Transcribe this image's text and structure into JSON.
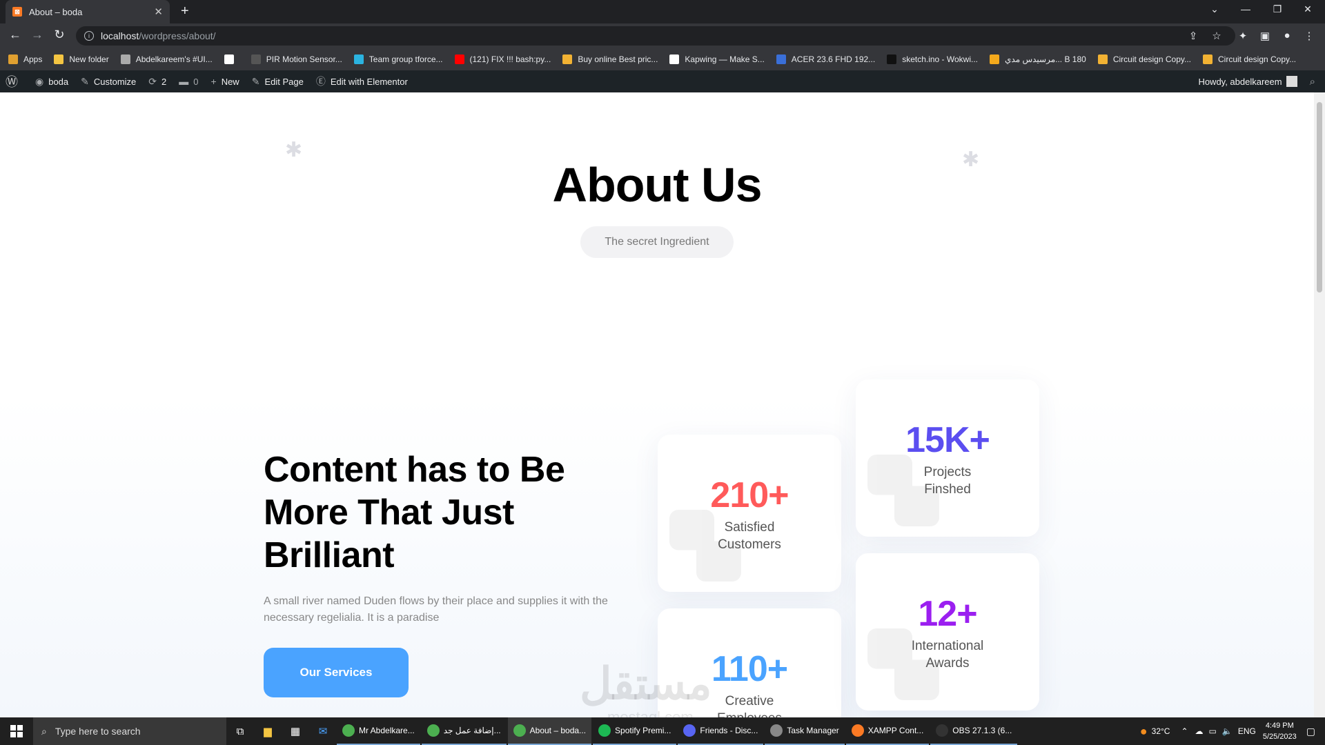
{
  "browser": {
    "tab_title": "About – boda",
    "url_host": "localhost",
    "url_path": "/wordpress/about/"
  },
  "bookmarks": [
    {
      "label": "Apps",
      "color": "#e0a030"
    },
    {
      "label": "New folder",
      "color": "#f4c542"
    },
    {
      "label": "Abdelkareem's #UI...",
      "color": "#aaaaaa"
    },
    {
      "label": "",
      "color": "#ffffff"
    },
    {
      "label": "PIR Motion Sensor...",
      "color": "#555555"
    },
    {
      "label": "Team group tforce...",
      "color": "#2bb3e0"
    },
    {
      "label": "(121) FIX !!! bash:py...",
      "color": "#ff0000"
    },
    {
      "label": "Buy online Best pric...",
      "color": "#f2b233"
    },
    {
      "label": "Kapwing — Make S...",
      "color": "#ffffff"
    },
    {
      "label": "ACER 23.6 FHD 192...",
      "color": "#3a6fd8"
    },
    {
      "label": "sketch.ino - Wokwi...",
      "color": "#111111"
    },
    {
      "label": "مرسيدس مدي... B 180",
      "color": "#f4a91c"
    },
    {
      "label": "Circuit design Copy...",
      "color": "#f2b233"
    },
    {
      "label": "Circuit design Copy...",
      "color": "#f2b233"
    }
  ],
  "adminbar": {
    "site": "boda",
    "customize": "Customize",
    "updates": "2",
    "comments": "0",
    "new": "New",
    "edit_page": "Edit Page",
    "elementor": "Edit with Elementor",
    "howdy": "Howdy, abdelkareem"
  },
  "hero": {
    "title": "About Us",
    "pill": "The secret Ingredient"
  },
  "content": {
    "heading": "Content has to Be More That Just Brilliant",
    "text": "A small river named Duden flows by their place and supplies it with the necessary regelialia. It is a paradise",
    "button": "Our Services"
  },
  "stats": [
    {
      "number": "210+",
      "label": "Satisfied Customers",
      "color": "#ff5a5a"
    },
    {
      "number": "15K+",
      "label": "Projects Finshed",
      "color": "#5b4ef0"
    },
    {
      "number": "110+",
      "label": "Creative Employees",
      "color": "#4aa3ff"
    },
    {
      "number": "12+",
      "label": "International Awards",
      "color": "#9b1ff0"
    }
  ],
  "watermark": {
    "text": "مستقل",
    "sub": "mostaql.com"
  },
  "taskbar": {
    "search_placeholder": "Type here to search",
    "apps": [
      "Mr Abdelkare...",
      "إضافة عمل جد...",
      "About – boda...",
      "Spotify Premi...",
      "Friends - Disc...",
      "Task Manager",
      "XAMPP Cont...",
      "OBS 27.1.3 (6..."
    ],
    "temperature": "32°C",
    "lang": "ENG",
    "time": "4:49 PM",
    "date": "5/25/2023"
  }
}
